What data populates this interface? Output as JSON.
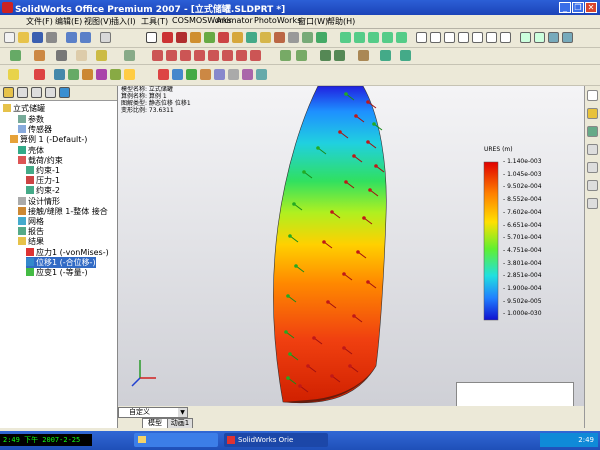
{
  "window": {
    "title": "SolidWorks Office Premium 2007 - [立式储罐.SLDPRT *]",
    "minimize_label": "_",
    "restore_label": "❐",
    "close_label": "✕"
  },
  "menu": [
    "文件(F)",
    "编辑(E)",
    "视图(V)",
    "插入(I)",
    "工具(T)",
    "COSMOSWorks",
    "Animator",
    "PhotoWorks",
    "窗口(W)",
    "帮助(H)"
  ],
  "feature_tree": {
    "root": "立式储罐",
    "items": [
      {
        "label": "参数",
        "level": 1
      },
      {
        "label": "传感器",
        "level": 1
      },
      {
        "label": "算例 1 (-Default-)",
        "level": 0
      },
      {
        "label": "壳体",
        "level": 1
      },
      {
        "label": "载荷/约束",
        "level": 1
      },
      {
        "label": "约束-1",
        "level": 2
      },
      {
        "label": "压力-1",
        "level": 2
      },
      {
        "label": "约束-2",
        "level": 2
      },
      {
        "label": "设计情形",
        "level": 1
      },
      {
        "label": "接触/缝隙 1-整体 接合",
        "level": 1
      },
      {
        "label": "网格",
        "level": 1
      },
      {
        "label": "报告",
        "level": 1
      },
      {
        "label": "结果",
        "level": 1
      },
      {
        "label": "应力1 (-vonMises-)",
        "level": 2
      },
      {
        "label": "位移1 (-合位移-)",
        "level": 2,
        "selected": true
      },
      {
        "label": "应变1 (-等量-)",
        "level": 2
      }
    ]
  },
  "plot_info": [
    "模型名称: 立式储罐",
    "算例名称: 算例 1",
    "图解类型: 静态位移 位移1",
    "变形比例: 73.6311"
  ],
  "legend": {
    "title": "URES (m)",
    "values": [
      "1.140e-003",
      "1.045e-003",
      "9.502e-004",
      "8.552e-004",
      "7.602e-004",
      "6.651e-004",
      "5.701e-004",
      "4.751e-004",
      "3.801e-004",
      "2.851e-004",
      "1.900e-004",
      "9.502e-005",
      "1.000e-030"
    ]
  },
  "bottom": {
    "view_select": "自定义",
    "tabs": [
      "模型",
      "动画1"
    ]
  },
  "taskbar": {
    "clock_text": "2:49 下午 2007-2-25",
    "task1": "",
    "task2": "SolidWorks Orie",
    "tray_time": "2:49"
  },
  "colors": {
    "title_blue": "#1b43b8",
    "toolbar_bg": "#ece9d8"
  }
}
